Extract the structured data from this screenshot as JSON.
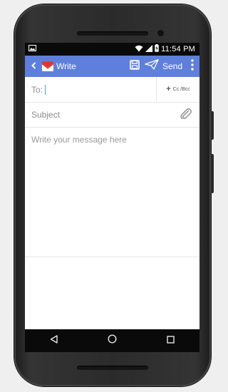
{
  "status_bar": {
    "time": "11:54 PM",
    "icons": [
      "image-icon",
      "wifi-icon",
      "signal-icon",
      "battery-charging-icon"
    ]
  },
  "app_bar": {
    "back_icon": "chevron-left-icon",
    "logo_icon": "mail-envelope-icon",
    "title": "Write",
    "save_icon": "floppy-disk-icon",
    "send_icon": "paper-plane-icon",
    "send_label": "Send",
    "menu_icon": "vertical-dots-icon"
  },
  "compose": {
    "to_label": "To:",
    "to_value": "",
    "cc_bcc_label": "Cc /Bcc",
    "subject_placeholder": "Subject",
    "body_placeholder": "Write your message here",
    "attach_icon": "paperclip-icon"
  },
  "nav_bar": {
    "icons": [
      "back-triangle-icon",
      "home-circle-icon",
      "recents-square-icon"
    ]
  },
  "colors": {
    "app_bar": "#5e7fdb",
    "status_bar": "#0a0a0a",
    "cursor": "#4a9de0",
    "logo_red": "#e0342e"
  }
}
